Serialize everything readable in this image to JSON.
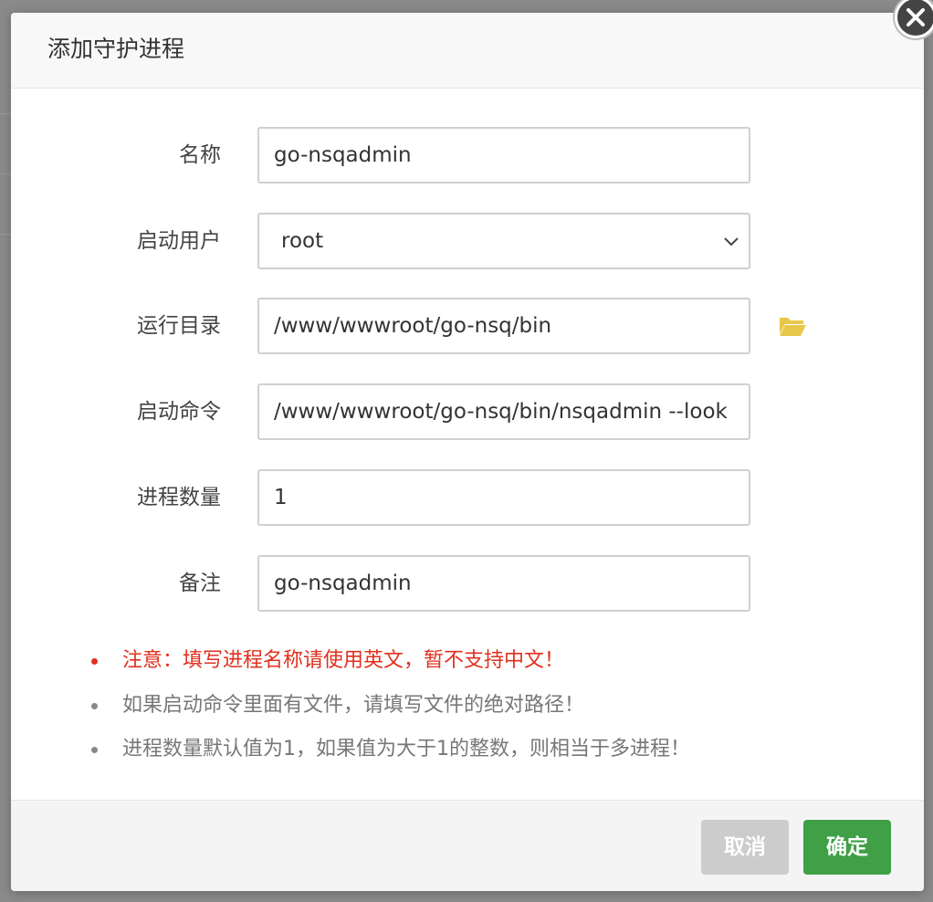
{
  "dialog": {
    "title": "添加守护进程",
    "close_icon": "close-icon"
  },
  "form": {
    "name": {
      "label": "名称",
      "value": "go-nsqadmin"
    },
    "user": {
      "label": "启动用户",
      "value": "root"
    },
    "directory": {
      "label": "运行目录",
      "value": "/www/wwwroot/go-nsq/bin",
      "icon": "folder-open-icon",
      "icon_color": "#e8c84a"
    },
    "command": {
      "label": "启动命令",
      "value": "/www/wwwroot/go-nsq/bin/nsqadmin --look"
    },
    "count": {
      "label": "进程数量",
      "value": "1"
    },
    "remark": {
      "label": "备注",
      "value": "go-nsqadmin"
    }
  },
  "notes": [
    {
      "text": "注意：填写进程名称请使用英文，暂不支持中文！",
      "color": "#e0301e"
    },
    {
      "text": "如果启动命令里面有文件，请填写文件的绝对路径！",
      "color": "#777777"
    },
    {
      "text": "进程数量默认值为1，如果值为大于1的整数，则相当于多进程！",
      "color": "#777777"
    }
  ],
  "footer": {
    "cancel_label": "取消",
    "confirm_label": "确定",
    "confirm_color": "#3fa047",
    "cancel_color": "#cccccc"
  }
}
